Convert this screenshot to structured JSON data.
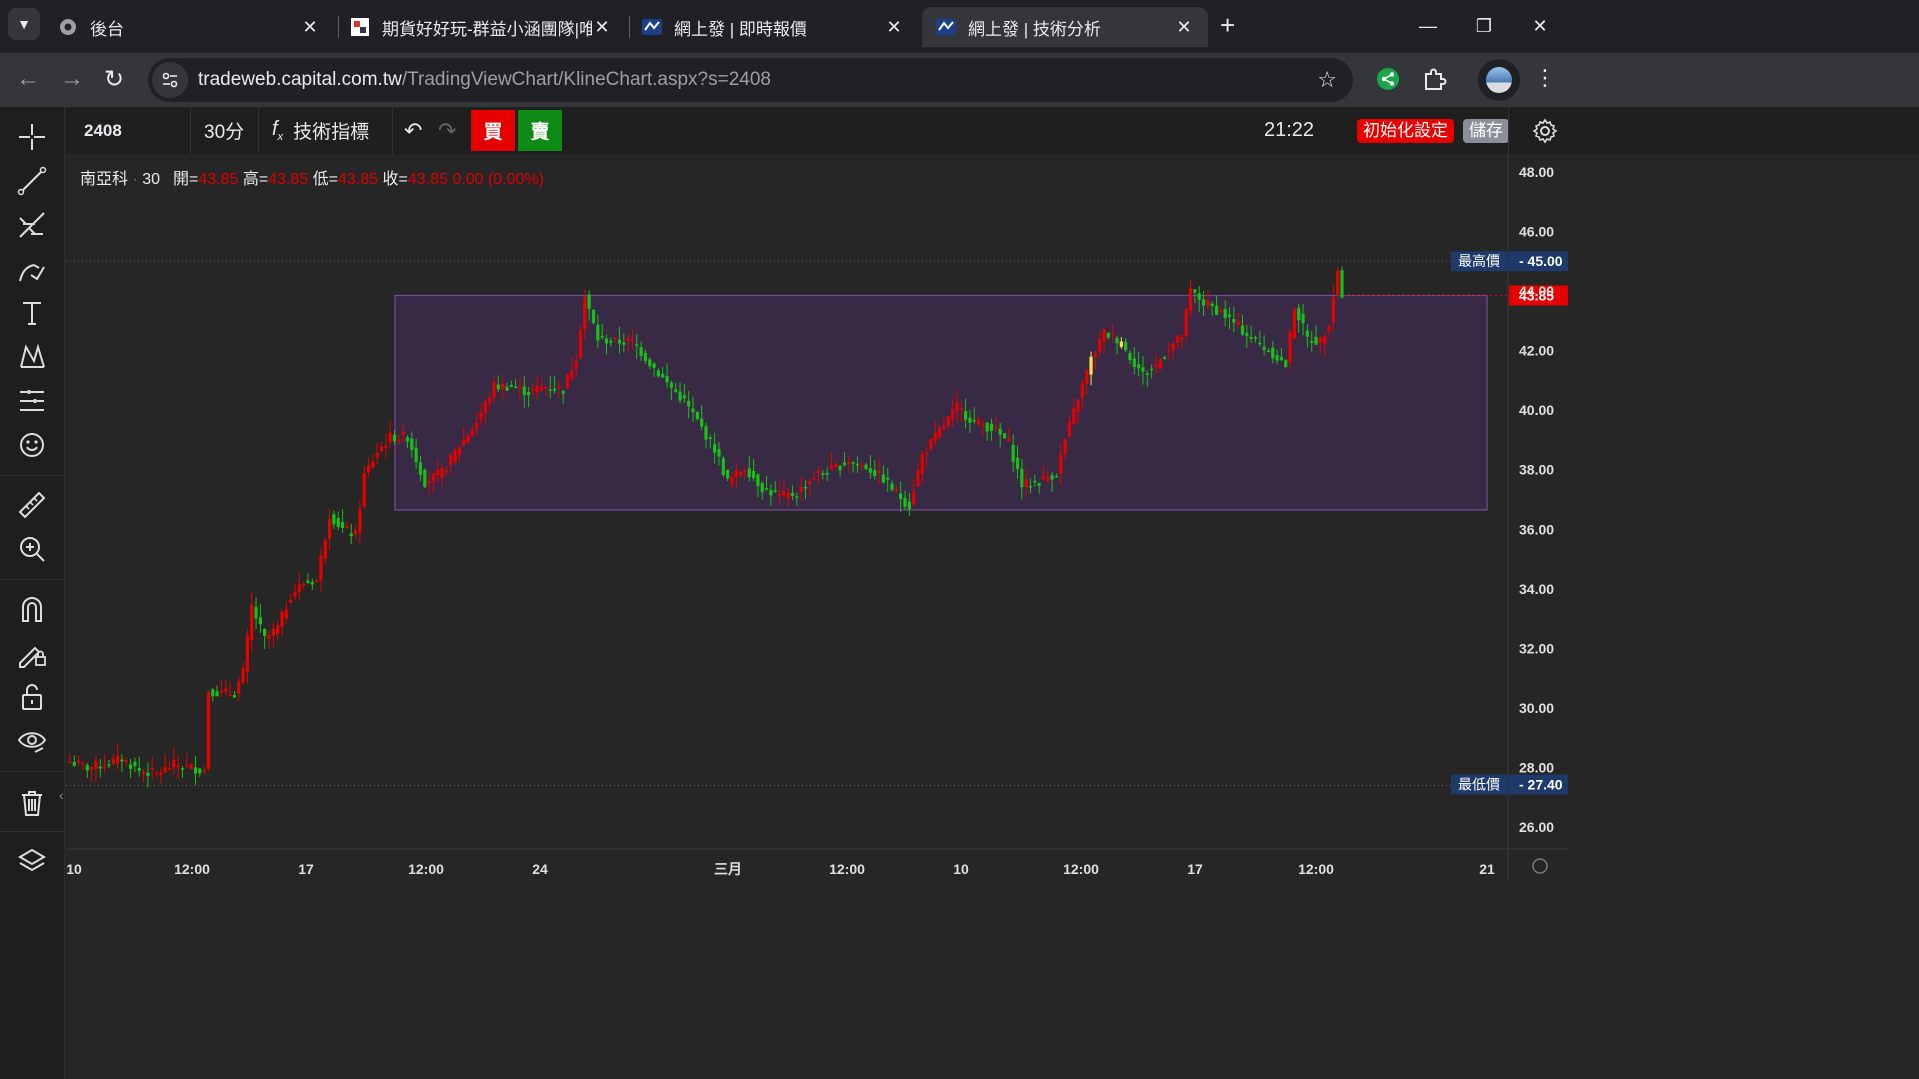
{
  "browser": {
    "tabs": [
      {
        "title": "後台",
        "active": false
      },
      {
        "title": "期貨好好玩-群益小涵團隊|唯一",
        "active": false
      },
      {
        "title": "網上發 | 即時報價",
        "active": false
      },
      {
        "title": "網上發 | 技術分析",
        "active": true
      }
    ],
    "new_tab_label": "+",
    "url_host": "tradeweb.capital.com.tw",
    "url_path": "/TradingViewChart/KlineChart.aspx?s=2408"
  },
  "chart_toolbar": {
    "symbol": "2408",
    "interval": "30分",
    "indicators_label": "技術指標",
    "buy_label": "買",
    "sell_label": "賣",
    "time": "21:22",
    "reset_label": "初始化設定",
    "save_label": "儲存"
  },
  "legend": {
    "name": "南亞科",
    "interval": "30",
    "open_label": "開=",
    "open": "43.85",
    "high_label": "高=",
    "high": "43.85",
    "low_label": "低=",
    "low": "43.85",
    "close_label": "收=",
    "close": "43.85",
    "change": "0.00 (0.00%)"
  },
  "colors": {
    "up": "#e60000",
    "down": "#18c018",
    "highlight": "#f5e050",
    "range_box_fill": "#3c2a4a",
    "range_box_border": "#7a4a9a"
  },
  "chart_data": {
    "type": "candlestick",
    "symbol": "2408",
    "interval": "30分",
    "y_range": [
      25.3,
      48.6
    ],
    "y_ticks": [
      "48.00",
      "46.00",
      "44.00",
      "42.00",
      "40.00",
      "38.00",
      "36.00",
      "34.00",
      "32.00",
      "30.00",
      "28.00",
      "26.00"
    ],
    "x_ticks": [
      "10",
      "12:00",
      "17",
      "12:00",
      "24",
      "三月",
      "12:00",
      "10",
      "12:00",
      "17",
      "12:00",
      "21"
    ],
    "max_price": {
      "label": "最高價",
      "value": "45.00"
    },
    "min_price": {
      "label": "最低價",
      "value": "27.40"
    },
    "last_price": "43.85",
    "range_box": {
      "top": 43.85,
      "bottom": 36.65
    },
    "close_path": [
      [
        0,
        28.2
      ],
      [
        4,
        28.0
      ],
      [
        8,
        28.1
      ],
      [
        12,
        28.3
      ],
      [
        16,
        27.9
      ],
      [
        20,
        27.8
      ],
      [
        24,
        28.1
      ],
      [
        28,
        28.0
      ],
      [
        31,
        27.9
      ],
      [
        32,
        30.6
      ],
      [
        35,
        30.5
      ],
      [
        38,
        30.5
      ],
      [
        40,
        31.2
      ],
      [
        42,
        33.4
      ],
      [
        45,
        32.3
      ],
      [
        48,
        32.7
      ],
      [
        51,
        33.8
      ],
      [
        54,
        34.2
      ],
      [
        57,
        34.3
      ],
      [
        60,
        36.5
      ],
      [
        63,
        36.0
      ],
      [
        66,
        35.8
      ],
      [
        68,
        37.8
      ],
      [
        71,
        38.6
      ],
      [
        74,
        39.1
      ],
      [
        78,
        39.1
      ],
      [
        82,
        37.6
      ],
      [
        86,
        37.9
      ],
      [
        90,
        38.8
      ],
      [
        94,
        39.6
      ],
      [
        98,
        40.8
      ],
      [
        102,
        40.8
      ],
      [
        106,
        40.6
      ],
      [
        110,
        40.8
      ],
      [
        114,
        40.7
      ],
      [
        117,
        41.8
      ],
      [
        119,
        43.8
      ],
      [
        122,
        42.4
      ],
      [
        126,
        42.3
      ],
      [
        130,
        42.3
      ],
      [
        134,
        41.6
      ],
      [
        138,
        40.9
      ],
      [
        142,
        40.3
      ],
      [
        146,
        39.4
      ],
      [
        149,
        38.7
      ],
      [
        152,
        37.6
      ],
      [
        156,
        38.1
      ],
      [
        160,
        37.4
      ],
      [
        164,
        37.1
      ],
      [
        168,
        37.2
      ],
      [
        172,
        37.8
      ],
      [
        176,
        38.0
      ],
      [
        180,
        38.3
      ],
      [
        184,
        38.1
      ],
      [
        188,
        37.7
      ],
      [
        191,
        37.2
      ],
      [
        194,
        36.8
      ],
      [
        197,
        38.5
      ],
      [
        201,
        39.3
      ],
      [
        205,
        40.1
      ],
      [
        209,
        39.6
      ],
      [
        213,
        39.4
      ],
      [
        217,
        38.9
      ],
      [
        220,
        37.5
      ],
      [
        224,
        37.6
      ],
      [
        228,
        37.9
      ],
      [
        230,
        39.0
      ],
      [
        233,
        40.4
      ],
      [
        236,
        41.7
      ],
      [
        239,
        42.6
      ],
      [
        242,
        42.4
      ],
      [
        245,
        41.8
      ],
      [
        248,
        41.2
      ],
      [
        251,
        41.5
      ],
      [
        254,
        42.1
      ],
      [
        257,
        42.5
      ],
      [
        259,
        44.0
      ],
      [
        262,
        43.6
      ],
      [
        266,
        43.3
      ],
      [
        270,
        42.8
      ],
      [
        274,
        42.3
      ],
      [
        278,
        41.9
      ],
      [
        281,
        41.5
      ],
      [
        283,
        43.5
      ],
      [
        286,
        42.4
      ],
      [
        289,
        42.3
      ],
      [
        291,
        43.0
      ],
      [
        293,
        44.7
      ],
      [
        294,
        43.85
      ]
    ],
    "highlighted_bars": [
      236,
      243
    ]
  }
}
